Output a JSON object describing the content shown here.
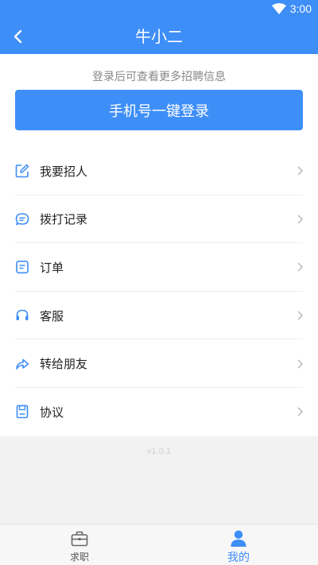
{
  "status_bar": {
    "time": "3:00",
    "icons": [
      "wifi-icon"
    ]
  },
  "app_bar": {
    "title": "牛小二",
    "back_icon": "back-arrow-icon"
  },
  "login": {
    "hint": "登录后可查看更多招聘信息",
    "button_label": "手机号一键登录"
  },
  "menu": {
    "items": [
      {
        "label": "我要招人",
        "icon": "edit-icon"
      },
      {
        "label": "拨打记录",
        "icon": "chat-bubble-icon"
      },
      {
        "label": "订单",
        "icon": "order-icon"
      },
      {
        "label": "客服",
        "icon": "headset-icon"
      },
      {
        "label": "转给朋友",
        "icon": "share-icon"
      },
      {
        "label": "协议",
        "icon": "document-icon"
      }
    ]
  },
  "version": "v1.0.1",
  "tab_bar": {
    "tabs": [
      {
        "label": "求职",
        "icon": "briefcase-icon",
        "active": false
      },
      {
        "label": "我的",
        "icon": "user-icon",
        "active": true
      }
    ]
  },
  "colors": {
    "primary": "#3e8ef7",
    "background": "#f2f2f2"
  }
}
